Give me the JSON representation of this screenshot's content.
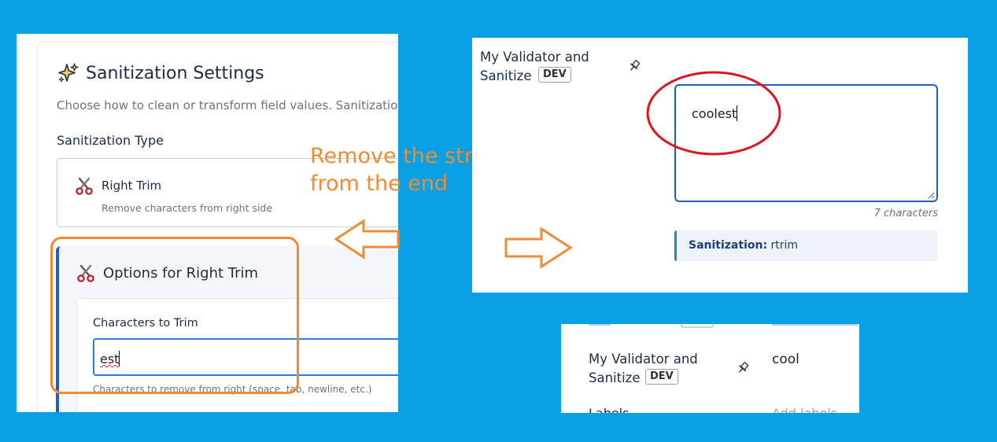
{
  "settings_panel": {
    "title": "Sanitization Settings",
    "description": "Choose how to clean or transform field values. Sanitization o",
    "type_label": "Sanitization Type",
    "selected_type": {
      "name": "Right Trim",
      "description": "Remove characters from right side"
    },
    "options": {
      "title": "Options for Right Trim",
      "field_label": "Characters to Trim",
      "field_value": "est",
      "field_hint": "Characters to remove from right (space, tab, newline, etc.)"
    }
  },
  "annotation": {
    "text": "Remove the string\nfrom the end",
    "color": "#f08a33"
  },
  "preview_panel": {
    "field_name": "My Validator and Sanitize",
    "badge": "DEV",
    "textarea_value": "coolest",
    "char_count": "7 characters",
    "sanitization_label": "Sanitization:",
    "sanitization_value": "rtrim"
  },
  "result_panel": {
    "field_name": "My Validator and Sanitize",
    "badge": "DEV",
    "value": "cool",
    "next_row_label": "Labels",
    "next_row_value": "Add labels"
  },
  "colors": {
    "background": "#0aa0e6",
    "accent_orange": "#f08a33",
    "highlight_red": "#e0141c",
    "primary_blue": "#1f5fbf"
  }
}
